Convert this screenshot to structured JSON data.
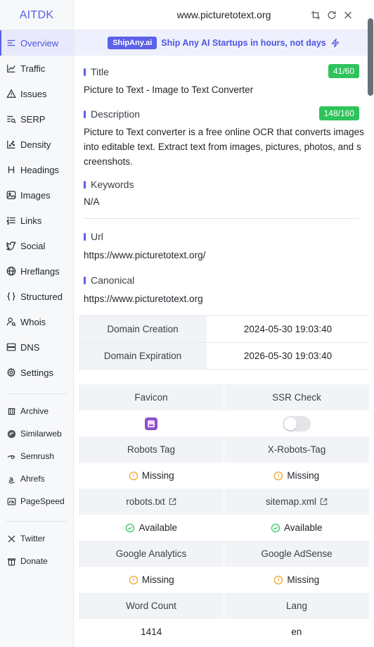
{
  "app": {
    "brand": "AITDK"
  },
  "sidebar": {
    "items": [
      {
        "label": "Overview",
        "icon": "overview-icon",
        "active": true
      },
      {
        "label": "Traffic",
        "icon": "traffic-icon"
      },
      {
        "label": "Issues",
        "icon": "issues-icon"
      },
      {
        "label": "SERP",
        "icon": "serp-icon"
      },
      {
        "label": "Density",
        "icon": "density-icon"
      },
      {
        "label": "Headings",
        "icon": "headings-icon"
      },
      {
        "label": "Images",
        "icon": "images-icon"
      },
      {
        "label": "Links",
        "icon": "links-icon"
      },
      {
        "label": "Social",
        "icon": "social-icon"
      },
      {
        "label": "Hreflangs",
        "icon": "hreflangs-icon"
      },
      {
        "label": "Structured",
        "icon": "structured-icon"
      },
      {
        "label": "Whois",
        "icon": "whois-icon"
      },
      {
        "label": "DNS",
        "icon": "dns-icon"
      },
      {
        "label": "Settings",
        "icon": "settings-icon"
      }
    ],
    "tools": [
      {
        "label": "Archive",
        "icon": "archive-icon"
      },
      {
        "label": "Similarweb",
        "icon": "similarweb-icon"
      },
      {
        "label": "Semrush",
        "icon": "semrush-icon"
      },
      {
        "label": "Ahrefs",
        "icon": "ahrefs-icon"
      },
      {
        "label": "PageSpeed",
        "icon": "pagespeed-icon"
      }
    ],
    "social": [
      {
        "label": "Twitter",
        "icon": "x-icon"
      },
      {
        "label": "Donate",
        "icon": "donate-icon"
      }
    ]
  },
  "header": {
    "domain": "www.picturetotext.org"
  },
  "banner": {
    "badge": "ShipAny.ai",
    "text": "Ship Any AI Startups in hours, not days"
  },
  "meta": {
    "title": {
      "label": "Title",
      "value": "Picture to Text - Image to Text Converter",
      "count": "41/60"
    },
    "description": {
      "label": "Description",
      "value": "Picture to Text converter is a free online OCR that converts images into editable text. Extract text from images, pictures, photos, and screenshots.",
      "count": "148/160"
    },
    "keywords": {
      "label": "Keywords",
      "value": "N/A"
    },
    "url": {
      "label": "Url",
      "value": "https://www.picturetotext.org/"
    },
    "canonical": {
      "label": "Canonical",
      "value": "https://www.picturetotext.org"
    }
  },
  "domain_info": [
    {
      "key": "Domain Creation",
      "value": "2024-05-30 19:03:40"
    },
    {
      "key": "Domain Expiration",
      "value": "2026-05-30 19:03:40"
    }
  ],
  "checks": {
    "favicon_label": "Favicon",
    "ssr_label": "SSR Check",
    "robots_tag_label": "Robots Tag",
    "x_robots_tag_label": "X-Robots-Tag",
    "robots_tag_value": "Missing",
    "x_robots_tag_value": "Missing",
    "robots_txt_label": "robots.txt",
    "sitemap_label": "sitemap.xml",
    "robots_txt_value": "Available",
    "sitemap_value": "Available",
    "ga_label": "Google Analytics",
    "adsense_label": "Google AdSense",
    "ga_value": "Missing",
    "adsense_value": "Missing",
    "word_count_label": "Word Count",
    "lang_label": "Lang",
    "word_count_value": "1414",
    "lang_value": "en"
  },
  "colors": {
    "accent": "#5b61e8",
    "ok": "#2fc35c",
    "warn": "#f0a020"
  }
}
